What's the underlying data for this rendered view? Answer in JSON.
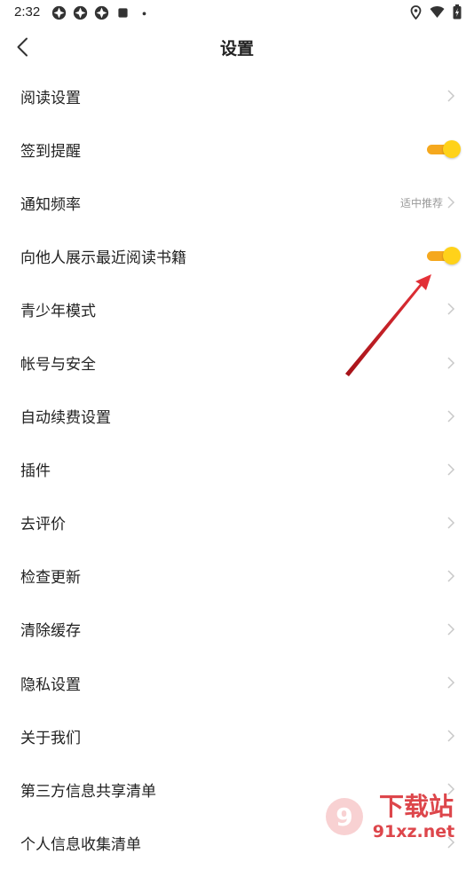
{
  "status_bar": {
    "time": "2:32",
    "left_icons": [
      "app-notification-icon",
      "app-notification-icon",
      "app-notification-icon",
      "square-notification-icon",
      "dot-icon"
    ],
    "right_icons": [
      "location-icon",
      "wifi-icon",
      "battery-icon"
    ]
  },
  "header": {
    "title": "设置"
  },
  "settings": [
    {
      "label": "阅读设置",
      "control": "chevron"
    },
    {
      "label": "签到提醒",
      "control": "toggle",
      "on": true
    },
    {
      "label": "通知频率",
      "control": "chevron",
      "value": "适中推荐"
    },
    {
      "label": "向他人展示最近阅读书籍",
      "control": "toggle",
      "on": true
    },
    {
      "label": "青少年模式",
      "control": "chevron"
    },
    {
      "label": "帐号与安全",
      "control": "chevron"
    },
    {
      "label": "自动续费设置",
      "control": "chevron"
    },
    {
      "label": "插件",
      "control": "chevron"
    },
    {
      "label": "去评价",
      "control": "chevron"
    },
    {
      "label": "检查更新",
      "control": "chevron"
    },
    {
      "label": "清除缓存",
      "control": "chevron"
    },
    {
      "label": "隐私设置",
      "control": "chevron"
    },
    {
      "label": "关于我们",
      "control": "chevron"
    },
    {
      "label": "第三方信息共享清单",
      "control": "chevron"
    },
    {
      "label": "个人信息收集清单",
      "control": "chevron"
    }
  ],
  "watermark": {
    "brand": "下载站",
    "domain": "91xz.net"
  },
  "colors": {
    "toggle_track": "#f5a81e",
    "toggle_thumb": "#ffd21a",
    "annotation_arrow": "#d6262b",
    "chevron": "#c8c8c8",
    "secondary_text": "#999999"
  }
}
